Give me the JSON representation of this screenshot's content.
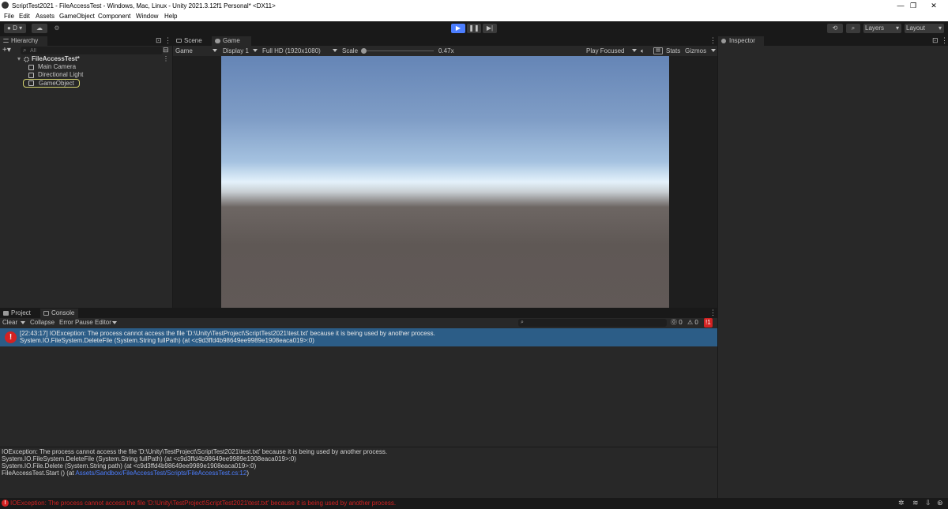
{
  "window": {
    "title": "ScriptTest2021 - FileAccessTest - Windows, Mac, Linux - Unity 2021.3.12f1 Personal* <DX11>",
    "controls": [
      "—",
      "❐",
      "✕"
    ]
  },
  "menu": [
    "File",
    "Edit",
    "Assets",
    "GameObject",
    "Component",
    "Window",
    "Help"
  ],
  "toolbar": {
    "account": "D",
    "layers": "Layers",
    "layout": "Layout"
  },
  "hierarchy": {
    "tab": "Hierarchy",
    "search_placeholder": "All",
    "scene": "FileAccessTest*",
    "items": [
      "Main Camera",
      "Directional Light",
      "GameObject"
    ]
  },
  "scene_tabs": [
    "Scene",
    "Game"
  ],
  "game": {
    "mode": "Game",
    "display": "Display 1",
    "resolution": "Full HD (1920x1080)",
    "scale_label": "Scale",
    "scale_value": "0.47x",
    "play_focused": "Play Focused",
    "stats": "Stats",
    "gizmos": "Gizmos"
  },
  "inspector": {
    "tab": "Inspector"
  },
  "bottom_tabs": [
    "Project",
    "Console"
  ],
  "console": {
    "clear": "Clear",
    "collapse": "Collapse",
    "error_pause": "Error Pause",
    "editor": "Editor",
    "count_log": "0",
    "count_warn": "0",
    "count_error": "1",
    "entry_line1": "[22:43:17] IOException: The process cannot access the file 'D:\\Unity\\TestProject\\ScriptTest2021\\test.txt' because it is being used by another process.",
    "entry_line2": "System.IO.FileSystem.DeleteFile (System.String fullPath) (at <c9d3ffd4b98649ee9989e1908eaca019>:0)",
    "stack_1": "IOException: The process cannot access the file 'D:\\Unity\\TestProject\\ScriptTest2021\\test.txt' because it is being used by another process.",
    "stack_2": "System.IO.FileSystem.DeleteFile (System.String fullPath) (at <c9d3ffd4b98649ee9989e1908eaca019>:0)",
    "stack_3": "System.IO.File.Delete (System.String path) (at <c9d3ffd4b98649ee9989e1908eaca019>:0)",
    "stack_4_prefix": "FileAccessTest.Start () (at ",
    "stack_4_link": "Assets/Sandbox/FileAccessTest/Scripts/FileAccessTest.cs:12",
    "stack_4_suffix": ")"
  },
  "statusbar": {
    "message": "IOException: The process cannot access the file 'D:\\Unity\\TestProject\\ScriptTest2021\\test.txt' because it is being used by another process."
  },
  "colors": {
    "accent_blue": "#2c5d87",
    "error_red": "#d32222",
    "link_blue": "#4c7eff",
    "panel": "#282828",
    "sky_top": "#6585b6",
    "ground": "#5d5654"
  }
}
